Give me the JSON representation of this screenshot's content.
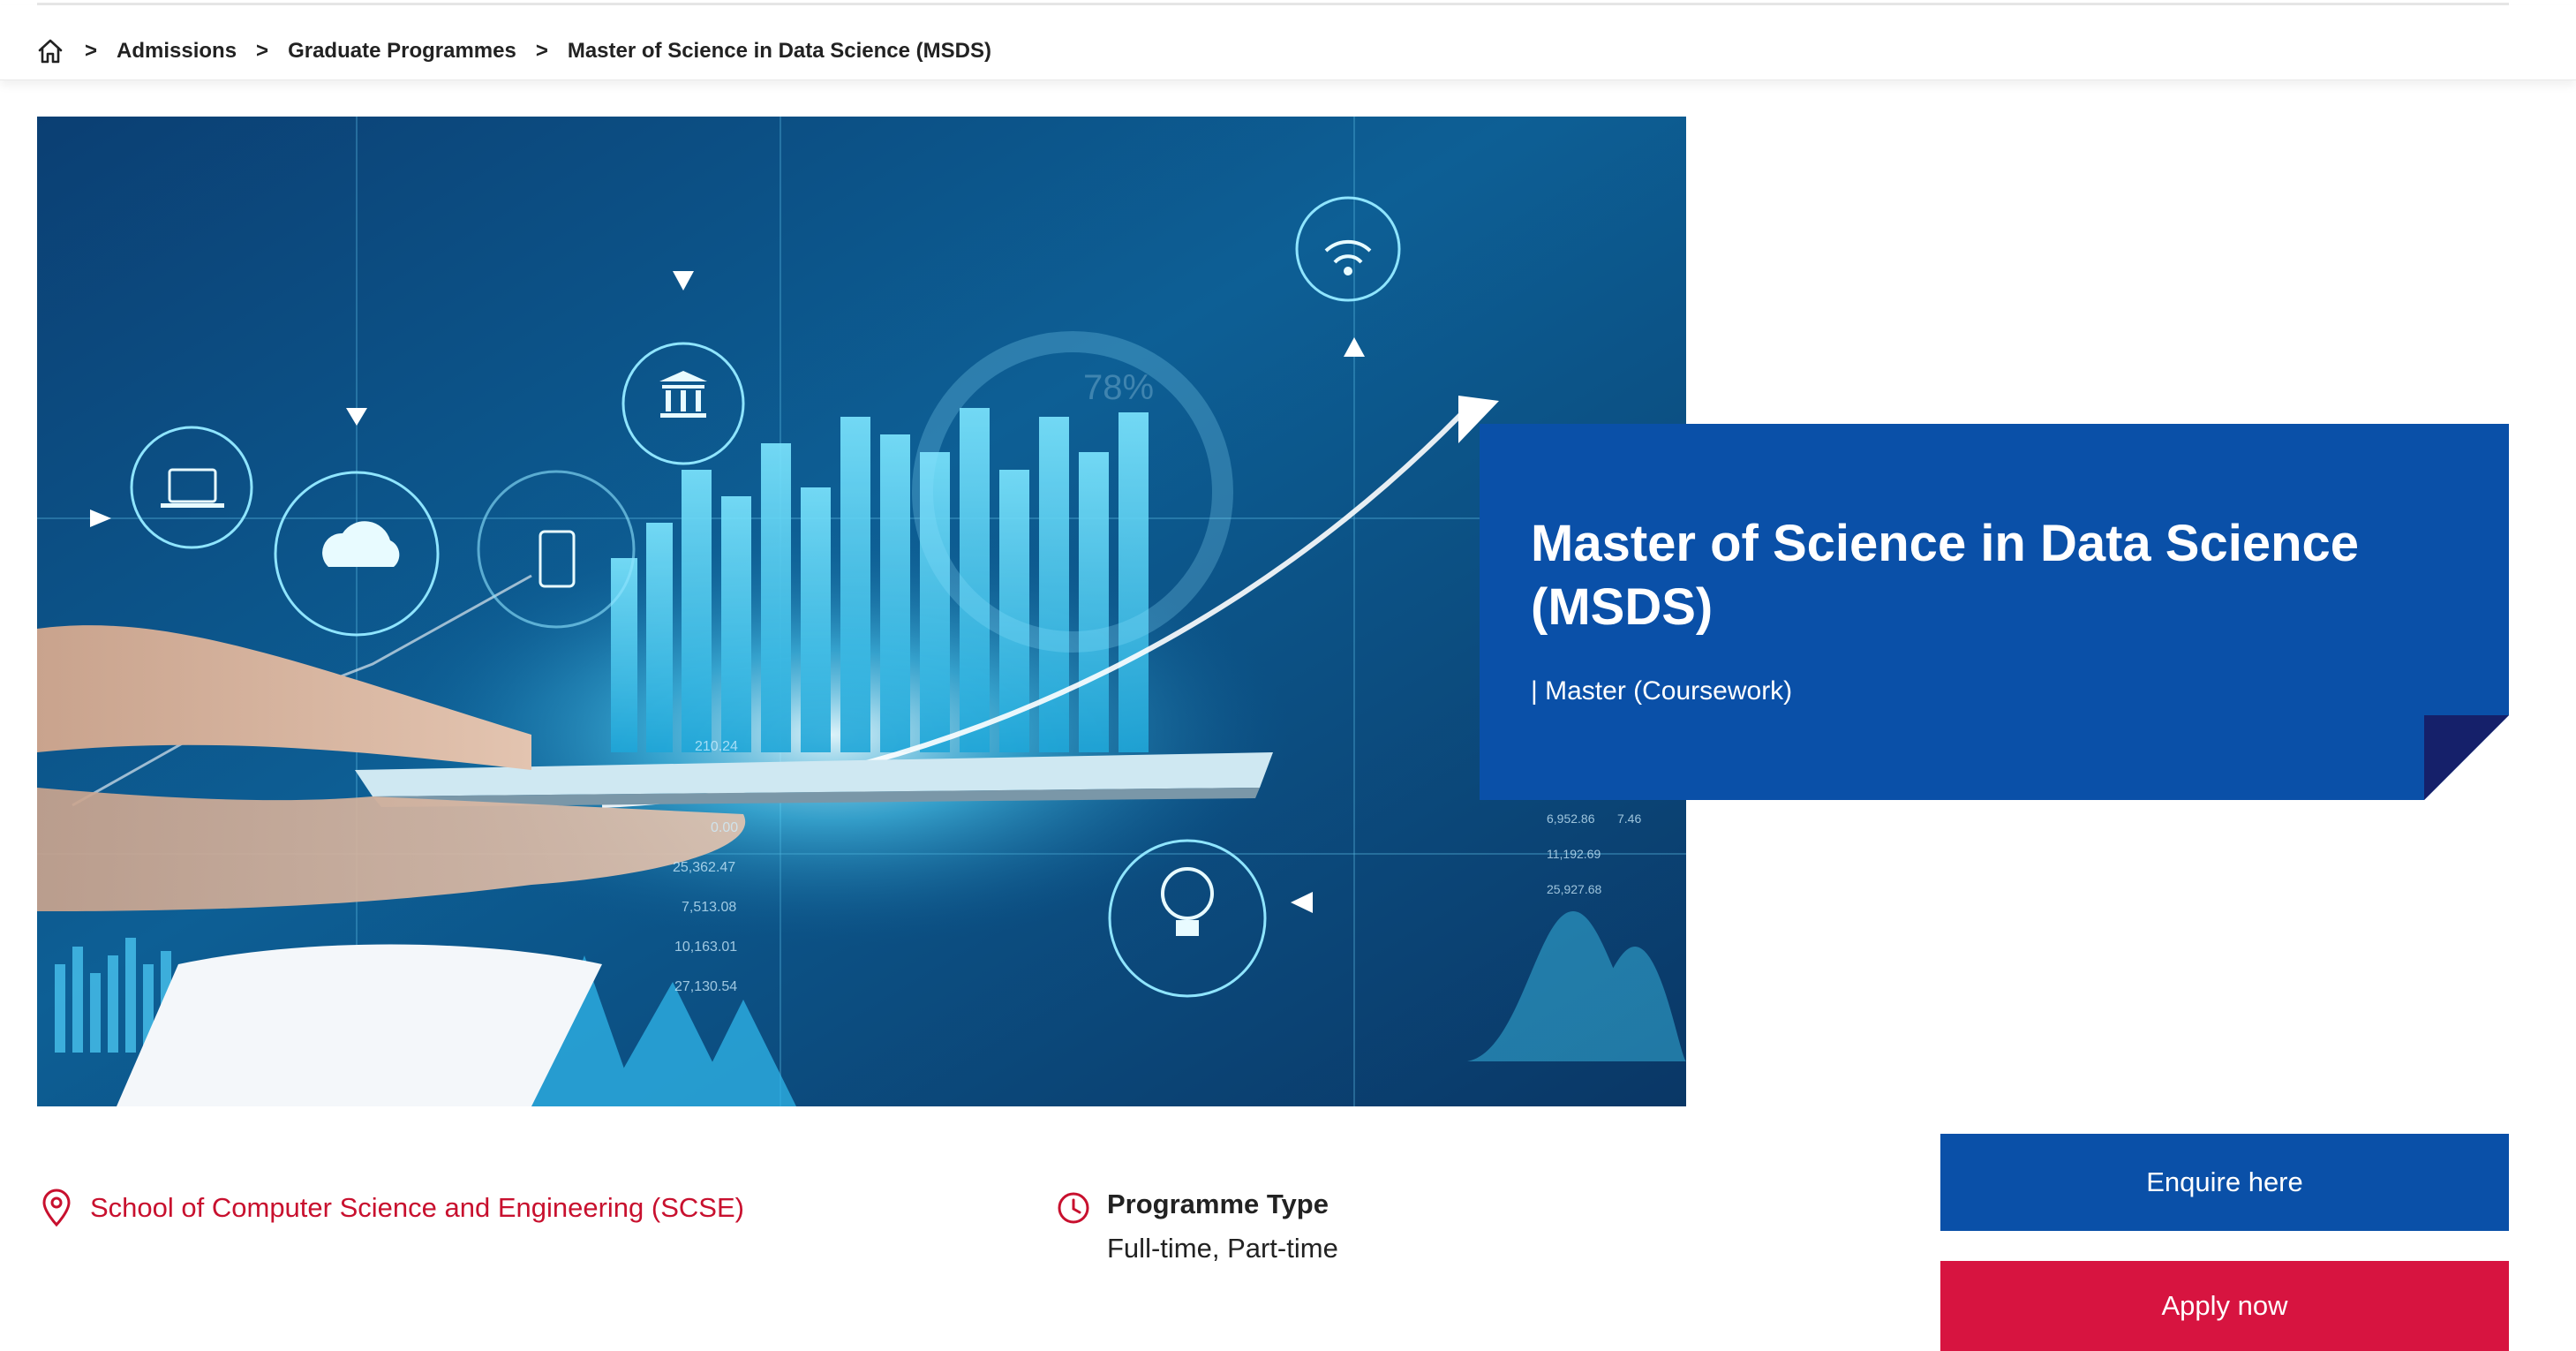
{
  "breadcrumb": {
    "home_icon": "home-icon",
    "separator": ">",
    "items": [
      "Admissions",
      "Graduate Programmes",
      "Master of Science in Data Science (MSDS)"
    ]
  },
  "hero": {
    "image_description_icon": "data-analytics-tablet-image",
    "overlay_texts": [
      "78%",
      "210.24",
      "0.00",
      "25,362.47",
      "7,513.08",
      "10,163.01",
      "27,130.54",
      "6,952.86",
      "7.46",
      "11,192.69",
      "25,927.68"
    ]
  },
  "title_card": {
    "title": "Master of Science in Data Science (MSDS)",
    "subtitle": "| Master (Coursework)"
  },
  "school": {
    "icon": "location-pin-icon",
    "label": "School of Computer Science and Engineering (SCSE)"
  },
  "programme_type": {
    "icon": "clock-icon",
    "label": "Programme Type",
    "value": "Full-time, Part-time"
  },
  "actions": {
    "enquire_label": "Enquire here",
    "apply_label": "Apply now"
  },
  "colors": {
    "primary_blue": "#0a50a8",
    "fold_navy": "#15206a",
    "apply_red": "#d71440",
    "link_red": "#c8102e"
  }
}
